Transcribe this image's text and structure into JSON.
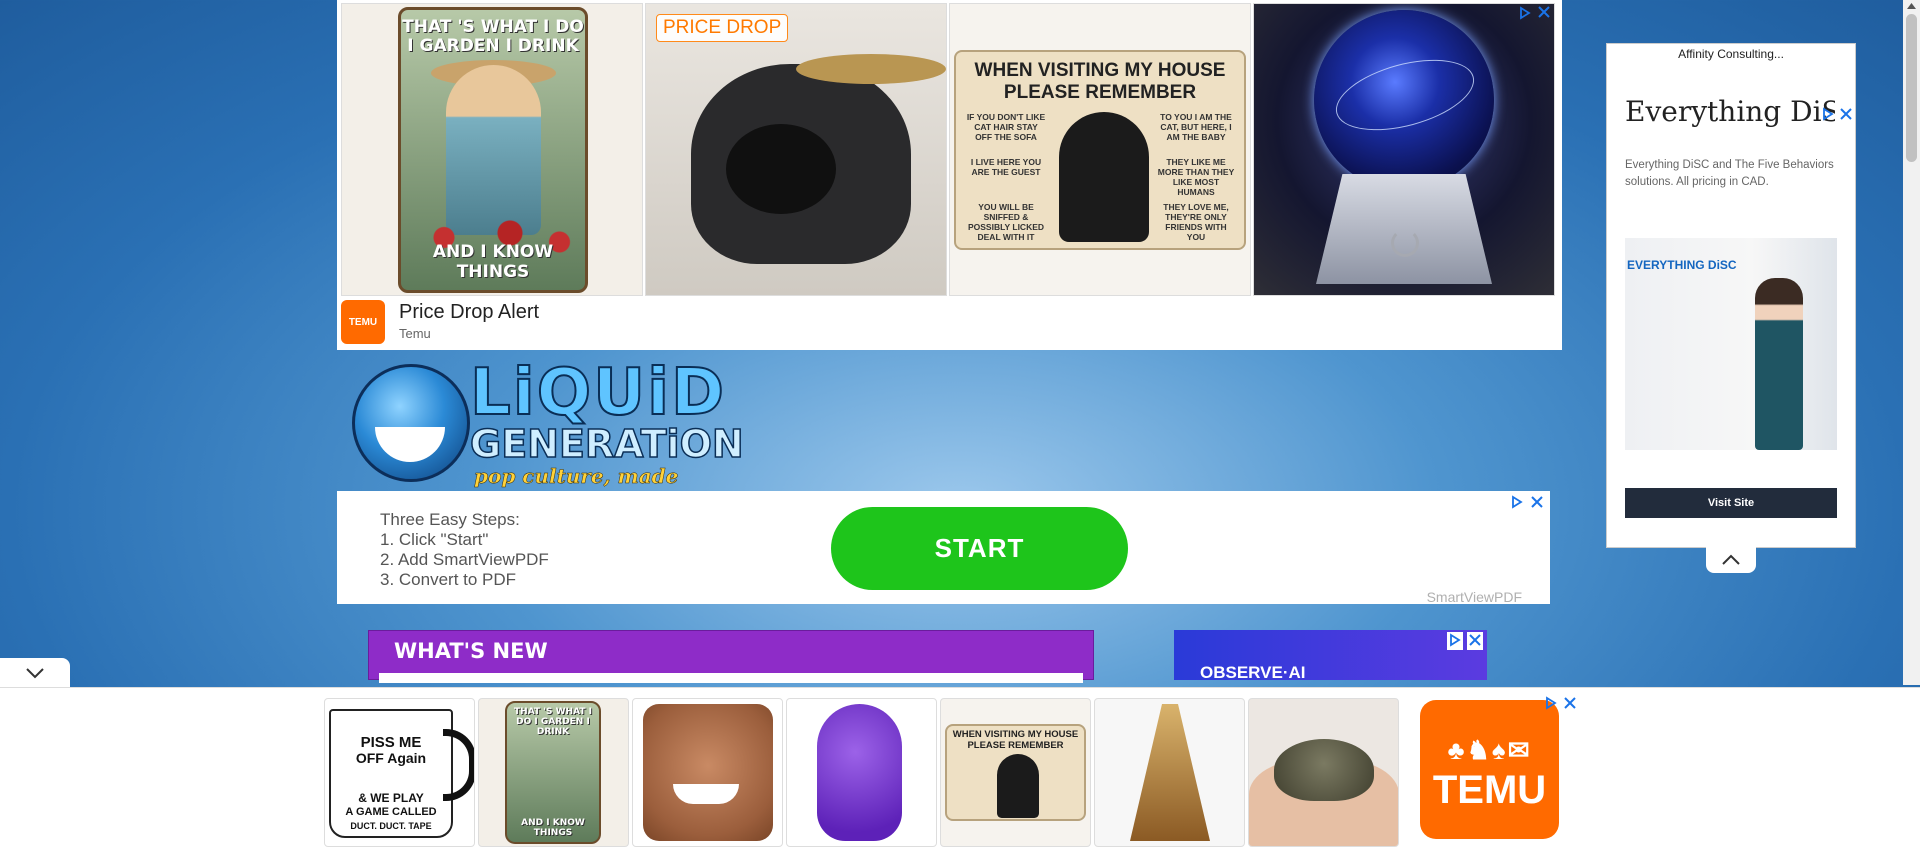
{
  "top_ad": {
    "badge": "PRICE DROP",
    "title": "Price Drop Alert",
    "brand": "Temu",
    "logo_text": "TEMU",
    "tile1_top": "THAT 'S WHAT I DO I GARDEN I DRINK",
    "tile1_bottom": "AND I KNOW THINGS",
    "tile3_title": "WHEN VISITING MY HOUSE PLEASE REMEMBER",
    "tile3_left": [
      "IF YOU DON'T LIKE CAT HAIR STAY OFF THE SOFA",
      "I LIVE HERE YOU ARE THE GUEST",
      "YOU WILL BE SNIFFED & POSSIBLY LICKED DEAL WITH IT"
    ],
    "tile3_right": [
      "TO YOU I AM THE CAT, BUT HERE, I AM THE BABY",
      "THEY LIKE ME MORE THAN THEY LIKE MOST HUMANS",
      "THEY LOVE ME, THEY'RE ONLY FRIENDS WITH YOU"
    ],
    "adchoices_icon": "adchoices-icon",
    "close_icon": "close-icon"
  },
  "logo": {
    "word1": "LiQUiD",
    "word2": "GENERATiON",
    "tagline": "pop culture, made funny."
  },
  "pdf_ad": {
    "steps": [
      "Three Easy Steps:",
      "1. Click \"Start\"",
      "2. Add SmartViewPDF",
      "3. Convert to PDF"
    ],
    "start_label": "START",
    "brand": "SmartViewPDF"
  },
  "whats_new": {
    "title": "WHAT'S NEW"
  },
  "observe_ad": {
    "text": "OBSERVE·AI"
  },
  "side_ad": {
    "top": "Affinity Consulting...",
    "title": "Everything DiSC",
    "description": "Everything DiSC and The Five Behaviors solutions. All pricing in CAD.",
    "image_logo": "EVERYTHING DiSC",
    "visit_label": "Visit Site"
  },
  "bottom_ad": {
    "mug_lines": [
      "PISS ME",
      "OFF Again",
      "& WE PLAY",
      "A GAME CALLED",
      "DUCT. DUCT. TAPE"
    ],
    "tile2_top": "THAT 'S WHAT I DO I GARDEN I DRINK",
    "tile2_bottom": "AND I KNOW THINGS",
    "tile5_title": "WHEN VISITING MY HOUSE PLEASE REMEMBER",
    "temu_label": "TEMU"
  },
  "colors": {
    "temu_orange": "#ff6a00",
    "start_green": "#1ec51b",
    "whats_new_purple": "#8e2cc8",
    "ad_blue": "#1a73e8"
  }
}
